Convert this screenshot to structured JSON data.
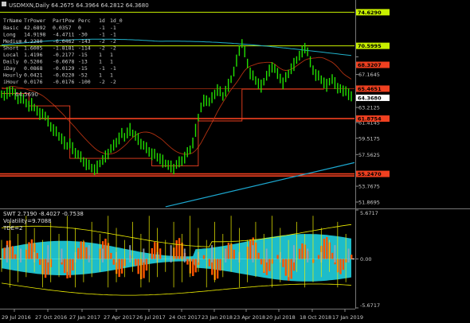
{
  "chart_data": [
    {
      "type": "line",
      "title": "USDMXN,Daily",
      "ohlc_header": "64.2675 64.3964 64.2812 64.3680",
      "x_ticks": [
        "29 Jul 2016",
        "27 Oct 2016",
        "27 Jan 2017",
        "27 Apr 2017",
        "26 Jul 2017",
        "24 Oct 2017",
        "23 Jan 2018",
        "23 Apr 2018",
        "20 Jul 2018",
        "18 Oct 2018",
        "17 Jan 2019"
      ],
      "y_ticks": [
        74.629,
        69.285,
        67.1645,
        65.1215,
        63.2125,
        61.4145,
        59.5175,
        57.5625,
        55.5275,
        53.7675,
        51.8695
      ],
      "y_tick_labels": [
        "74.6290",
        "",
        "",
        "67.1645",
        "",
        "63.2125",
        "61.4145",
        "59.5175",
        "57.5625",
        "",
        "53.7675",
        "51.8695"
      ],
      "ylim": [
        51.2,
        76.0
      ],
      "price_labels": [
        {
          "text": "74.6290",
          "value": 74.629,
          "color": "#c8f000"
        },
        {
          "text": "70.5995",
          "value": 70.5995,
          "color": "#c8f000"
        },
        {
          "text": "68.3207",
          "value": 68.3207,
          "color": "#f04020"
        },
        {
          "text": "65.4651",
          "value": 65.4651,
          "color": "#f04020"
        },
        {
          "text": "64.3680",
          "value": 64.368,
          "color": "#ffffff"
        },
        {
          "text": "61.8754",
          "value": 61.8754,
          "color": "#f04020"
        },
        {
          "text": "55.2470",
          "value": 55.247,
          "color": "#f04020"
        }
      ],
      "h_levels": [
        {
          "value": 74.629,
          "color": "#c8f000"
        },
        {
          "value": 70.5995,
          "color": "#c8f000"
        },
        {
          "value": 61.8754,
          "color": "#f04020"
        },
        {
          "value": 55.247,
          "color": "#f04020"
        },
        {
          "value": 55.0,
          "color": "#f04020"
        }
      ],
      "series": [
        {
          "color": "#22e000",
          "values": [
            64.8,
            64.6,
            64.9,
            65.3,
            65.1,
            64.7,
            64.3,
            64.5,
            64.1,
            63.8,
            63.4,
            63.6,
            63.2,
            62.8,
            62.4,
            62.6,
            62.1,
            61.5,
            61.0,
            60.6,
            60.2,
            59.8,
            59.5,
            59.0,
            58.6,
            58.9,
            58.3,
            57.9,
            57.5,
            57.2,
            56.8,
            56.5,
            56.2,
            56.0,
            55.8,
            56.1,
            56.5,
            56.9,
            57.3,
            57.8,
            58.2,
            58.6,
            59.1,
            59.6,
            60.0,
            59.7,
            60.2,
            60.6,
            60.1,
            59.8,
            59.4,
            59.0,
            58.6,
            58.3,
            58.0,
            57.7,
            57.5,
            57.3,
            57.1,
            56.8,
            56.5,
            56.3,
            56.1,
            56.0,
            56.3,
            56.6,
            56.9,
            57.3,
            57.7,
            58.2,
            59.0,
            60.5,
            62.0,
            63.2,
            64.0,
            64.2,
            63.8,
            64.3,
            64.9,
            65.4,
            65.0,
            64.6,
            65.2,
            65.9,
            66.6,
            67.5,
            68.8,
            70.2,
            70.8,
            69.8,
            68.6,
            67.4,
            66.9,
            66.5,
            66.1,
            65.8,
            66.3,
            67.0,
            67.6,
            68.2,
            67.8,
            67.2,
            66.8,
            66.2,
            66.7,
            67.3,
            67.9,
            68.4,
            68.9,
            69.4,
            69.9,
            70.5,
            69.8,
            68.6,
            67.8,
            67.2,
            66.9,
            66.6,
            66.2,
            65.9,
            66.3,
            66.6,
            66.1,
            65.7,
            65.4,
            65.1,
            65.3,
            64.9,
            64.4
          ]
        }
      ]
    },
    {
      "type": "area",
      "ylim": [
        -5.6717,
        5.6717
      ],
      "y_tick_labels": [
        "5.6717",
        "0.00",
        "-5.6717"
      ],
      "zero_line_value": 0.0
    }
  ],
  "overlay": {
    "title_line": "USDMXN,Daily  64.2675 64.3964 64.2812 64.3680",
    "table": {
      "headers": [
        "TrName",
        "TrPower",
        "PartPow",
        "Perc",
        "1d",
        "1d_0"
      ],
      "rows": [
        [
          "Basic",
          "42.6892",
          "0.0357",
          "0",
          "-1",
          "-1"
        ],
        [
          "Long",
          "14.9198",
          "-4.4711",
          "-30",
          "-1",
          "-1"
        ],
        [
          "Medium",
          "4.2280",
          "-6.0462",
          "-143",
          "-2",
          "-2"
        ],
        [
          "Short",
          "1.6005",
          "-1.8181",
          "-114",
          "-2",
          "-2"
        ],
        [
          "Local",
          "1.4196",
          "-0.2177",
          "-15",
          "1",
          "1"
        ],
        [
          "Daily",
          "0.5206",
          "-0.0678",
          "-13",
          "1",
          "1"
        ],
        [
          "iDay",
          "0.0868",
          "-0.0129",
          "-15",
          "-1",
          "-1"
        ],
        [
          "Hourly",
          "0.0421",
          "-0.0220",
          "-52",
          "1",
          "1"
        ],
        [
          "iHour",
          "0.0176",
          "-0.0176",
          "-100",
          "-2",
          "-2"
        ]
      ]
    },
    "partial_value": "64.5690",
    "indicator": {
      "line1": "SWT 2.7190 -8.4027 -0.7538",
      "line2": "Volatility=9.7088",
      "line3": "TDE=2"
    }
  },
  "colors": {
    "background": "#000000",
    "price": "#22e000",
    "support_resistance": "#f04020",
    "band": "#c8f000",
    "ma_cyan": "#20b0c8",
    "ma_dark": "#b03010",
    "channel_cyan": "#1ca8d0",
    "ind_cyan": "#20d0e0",
    "ind_orange": "#ff5500",
    "ind_yellow": "#f0f000",
    "ind_gray": "#9aa6b8"
  }
}
